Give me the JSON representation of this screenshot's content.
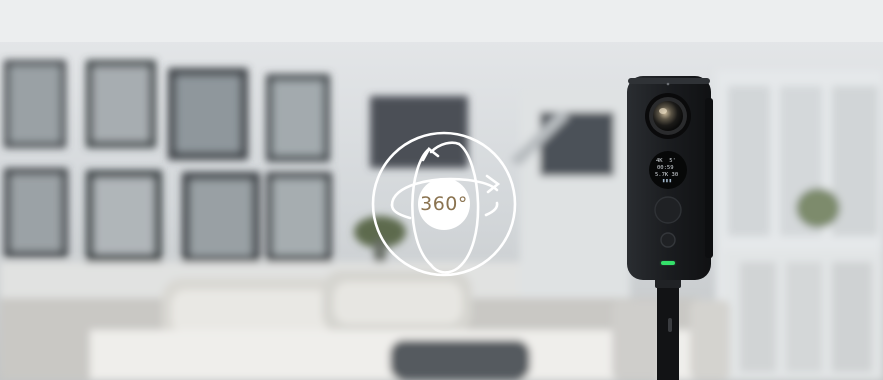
{
  "image": {
    "kind": "product-photo",
    "subject": "360 camera on a selfie stick in a blurred dining room"
  },
  "overlay": {
    "badge_text": "360°",
    "badge_color": "#8a7350",
    "ring_color": "#ffffff"
  },
  "camera": {
    "body_color": "#1b1d20",
    "status_led_color": "#35e06a",
    "screen": {
      "line1": "4K  5'",
      "line2": "00:59",
      "line3": "5.7K 30",
      "line4": "▮▮▮"
    }
  },
  "colors": {
    "wall": "#cfd3d6",
    "ceiling": "#e6e8ea",
    "frame": "#3d4246",
    "table": "#e9e7e3"
  }
}
